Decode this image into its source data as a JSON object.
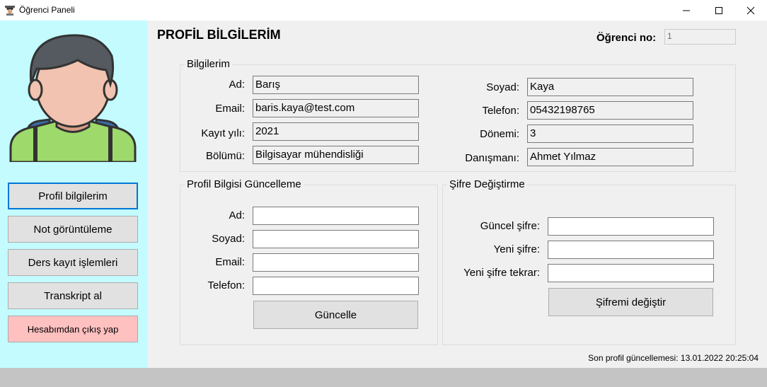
{
  "window": {
    "title": "Öğrenci Paneli",
    "app_icon": "student-icon",
    "controls": [
      "minimize-icon",
      "maximize-icon",
      "close-icon"
    ]
  },
  "sidebar": {
    "avatar": "student-avatar",
    "items": [
      {
        "label": "Profil bilgilerim",
        "active": true
      },
      {
        "label": "Not görüntüleme"
      },
      {
        "label": "Ders kayıt işlemleri"
      },
      {
        "label": "Transkript al"
      },
      {
        "label": "Hesabımdan çıkış yap",
        "color": "#ffc0c0"
      }
    ]
  },
  "header": {
    "title": "PROFİL BİLGİLERİM",
    "student_no_label": "Öğrenci no:",
    "student_no_value": "1"
  },
  "info": {
    "title": "Bilgilerim",
    "left": [
      {
        "label": "Ad:",
        "value": "Barış"
      },
      {
        "label": "Email:",
        "value": "baris.kaya@test.com"
      },
      {
        "label": "Kayıt yılı:",
        "value": "2021"
      },
      {
        "label": "Bölümü:",
        "value": "Bilgisayar mühendisliği"
      }
    ],
    "right": [
      {
        "label": "Soyad:",
        "value": "Kaya"
      },
      {
        "label": "Telefon:",
        "value": "05432198765"
      },
      {
        "label": "Dönemi:",
        "value": "3"
      },
      {
        "label": "Danışmanı:",
        "value": "Ahmet Yılmaz"
      }
    ]
  },
  "update": {
    "title": "Profil Bilgisi Güncelleme",
    "fields": [
      {
        "label": "Ad:",
        "value": ""
      },
      {
        "label": "Soyad:",
        "value": ""
      },
      {
        "label": "Email:",
        "value": ""
      },
      {
        "label": "Telefon:",
        "value": ""
      }
    ],
    "button": "Güncelle"
  },
  "password": {
    "title": "Şifre Değiştirme",
    "fields": [
      {
        "label": "Güncel şifre:",
        "value": ""
      },
      {
        "label": "Yeni şifre:",
        "value": ""
      },
      {
        "label": "Yeni şifre tekrar:",
        "value": ""
      }
    ],
    "button": "Şifremi değiştir"
  },
  "status": {
    "text": "Son profil güncellemesi: 13.01.2022 20:25:04"
  },
  "colors": {
    "sidebar_bg": "#c3fbff",
    "logout_bg": "#ffc0c0",
    "accent": "#0078d7"
  }
}
